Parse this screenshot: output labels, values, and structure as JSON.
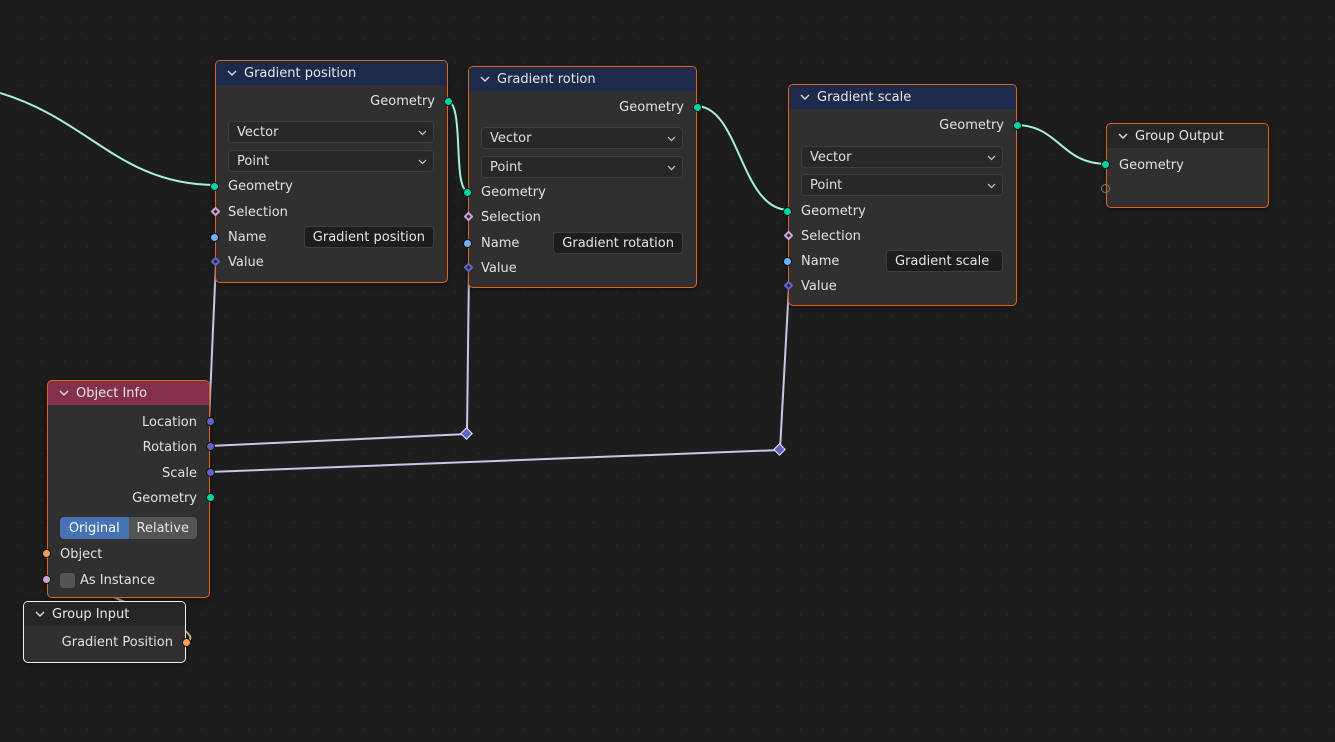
{
  "colors": {
    "geometry_link": "#a8f0d6",
    "vector_link": "#c8c8e6",
    "object_link": "#c8b8a0",
    "selected_border": "#e0641e"
  },
  "nodes": {
    "gradient_position": {
      "title": "Gradient position",
      "output": "Geometry",
      "data_type": "Vector",
      "domain": "Point",
      "inputs": [
        "Geometry",
        "Selection",
        "Name",
        "Value"
      ],
      "name_value": "Gradient position"
    },
    "gradient_rotation": {
      "title": "Gradient rotion",
      "output": "Geometry",
      "data_type": "Vector",
      "domain": "Point",
      "inputs": [
        "Geometry",
        "Selection",
        "Name",
        "Value"
      ],
      "name_value": "Gradient rotation"
    },
    "gradient_scale": {
      "title": "Gradient scale",
      "output": "Geometry",
      "data_type": "Vector",
      "domain": "Point",
      "inputs": [
        "Geometry",
        "Selection",
        "Name",
        "Value"
      ],
      "name_value": "Gradient scale"
    },
    "group_output": {
      "title": "Group Output",
      "inputs": [
        "Geometry"
      ]
    },
    "object_info": {
      "title": "Object Info",
      "outputs": [
        "Location",
        "Rotation",
        "Scale",
        "Geometry"
      ],
      "transform_space": {
        "options": [
          "Original",
          "Relative"
        ],
        "selected": "Original"
      },
      "inputs": [
        "Object",
        "As Instance"
      ],
      "as_instance_checked": false
    },
    "group_input": {
      "title": "Group Input",
      "outputs": [
        "Gradient Position"
      ]
    }
  }
}
